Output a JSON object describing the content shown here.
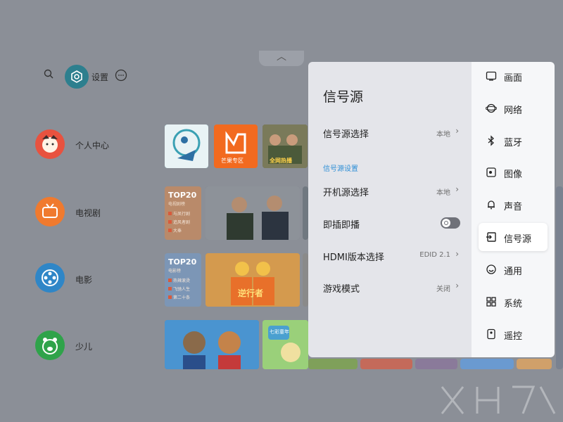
{
  "topbar": {
    "settings_label": "设置"
  },
  "categories": [
    {
      "label": "个人中心",
      "color": "#e8523f"
    },
    {
      "label": "电视剧",
      "color": "#f07a2e"
    },
    {
      "label": "电影",
      "color": "#2f86c7"
    },
    {
      "label": "少儿",
      "color": "#2fa34a"
    }
  ],
  "tiles": {
    "mango_label": "芒果专区",
    "show_label": "全网热播",
    "top20_a": {
      "title": "TOP20",
      "sub": "电视剧榜",
      "rows": [
        "与凤行剧",
        "追风者剧",
        "大奉"
      ]
    },
    "top20_b": {
      "title": "TOP20",
      "sub": "电影榜",
      "rows": [
        "热辣滚烫",
        "飞驰人生",
        "第二十条"
      ]
    },
    "movie_label": "逆行者",
    "kids_label": "七彩童年"
  },
  "panel": {
    "title": "信号源",
    "rows": [
      {
        "label": "信号源选择",
        "value": "本地"
      }
    ],
    "section_label": "信号源设置",
    "settings": [
      {
        "label": "开机源选择",
        "value": "本地"
      },
      {
        "label": "即插即播",
        "value": "",
        "toggle": true
      },
      {
        "label": "HDMI版本选择",
        "value": "EDID 2.1"
      },
      {
        "label": "游戏模式",
        "value": "关闭"
      }
    ]
  },
  "menu": [
    {
      "label": "画面",
      "icon": "picture-icon"
    },
    {
      "label": "网络",
      "icon": "network-icon"
    },
    {
      "label": "蓝牙",
      "icon": "bluetooth-icon"
    },
    {
      "label": "图像",
      "icon": "image-icon"
    },
    {
      "label": "声音",
      "icon": "bell-icon"
    },
    {
      "label": "信号源",
      "icon": "input-source-icon",
      "active": true
    },
    {
      "label": "通用",
      "icon": "smile-icon"
    },
    {
      "label": "系统",
      "icon": "grid-icon"
    },
    {
      "label": "遥控",
      "icon": "remote-icon"
    }
  ],
  "colors": {
    "accent": "#2f8fd6",
    "settings_pill": "#2d7f8e"
  }
}
